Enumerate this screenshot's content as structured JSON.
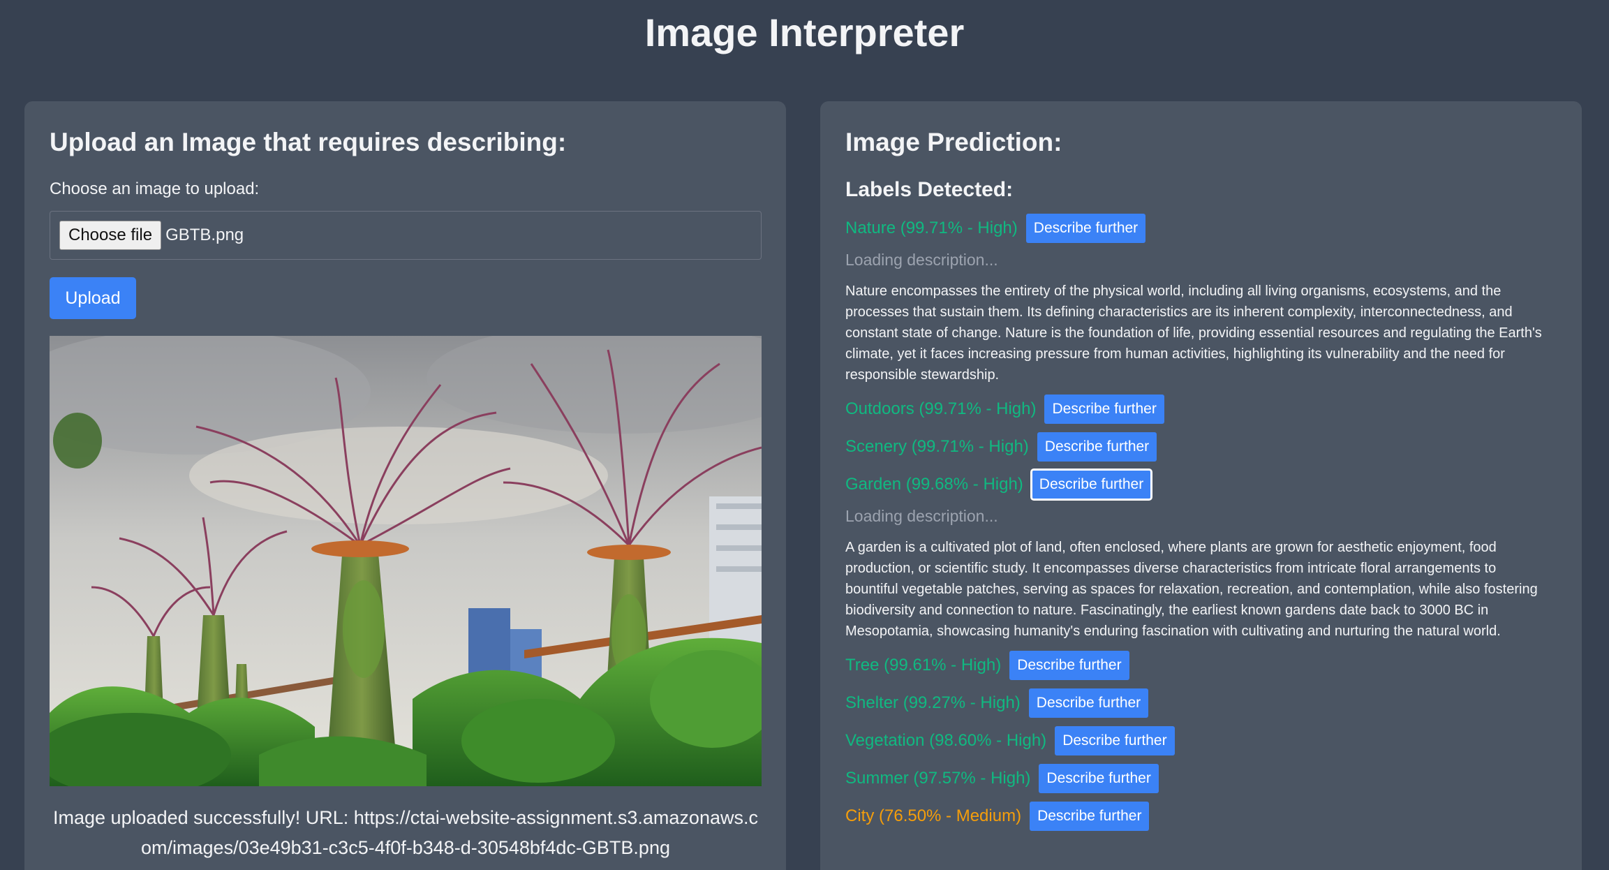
{
  "app": {
    "title": "Image Interpreter"
  },
  "upload_panel": {
    "heading": "Upload an Image that requires describing:",
    "choose_label": "Choose an image to upload:",
    "choose_button": "Choose file",
    "file_name": "GBTB.png",
    "upload_button": "Upload",
    "status_message": "Image uploaded successfully! URL: https://ctai-website-assignment.s3.amazonaws.com/images/03e49b31-c3c5-4f0f-b348-d-30548bf4dc-GBTB.png"
  },
  "prediction_panel": {
    "heading": "Image Prediction:",
    "labels_heading": "Labels Detected:",
    "describe_label": "Describe further",
    "loading_text": "Loading description...",
    "labels": [
      {
        "text": "Nature (99.71% - High)",
        "confidence": "High"
      },
      {
        "text": "Outdoors (99.71% - High)",
        "confidence": "High"
      },
      {
        "text": "Scenery (99.71% - High)",
        "confidence": "High"
      },
      {
        "text": "Garden (99.68% - High)",
        "confidence": "High"
      },
      {
        "text": "Tree (99.61% - High)",
        "confidence": "High"
      },
      {
        "text": "Shelter (99.27% - High)",
        "confidence": "High"
      },
      {
        "text": "Vegetation (98.60% - High)",
        "confidence": "High"
      },
      {
        "text": "Summer (97.57% - High)",
        "confidence": "High"
      },
      {
        "text": "City (76.50% - Medium)",
        "confidence": "Medium"
      }
    ],
    "descriptions": {
      "nature": "Nature encompasses the entirety of the physical world, including all living organisms, ecosystems, and the processes that sustain them. Its defining characteristics are its inherent complexity, interconnectedness, and constant state of change. Nature is the foundation of life, providing essential resources and regulating the Earth's climate, yet it faces increasing pressure from human activities, highlighting its vulnerability and the need for responsible stewardship.",
      "garden": "A garden is a cultivated plot of land, often enclosed, where plants are grown for aesthetic enjoyment, food production, or scientific study. It encompasses diverse characteristics from intricate floral arrangements to bountiful vegetable patches, serving as spaces for relaxation, recreation, and contemplation, while also fostering biodiversity and connection to nature. Fascinatingly, the earliest known gardens date back to 3000 BC in Mesopotamia, showcasing humanity's enduring fascination with cultivating and nurturing the natural world."
    }
  },
  "colors": {
    "background": "#374151",
    "panel": "#4b5563",
    "accent": "#3b82f6",
    "high": "#10b981",
    "medium": "#f59e0b"
  }
}
